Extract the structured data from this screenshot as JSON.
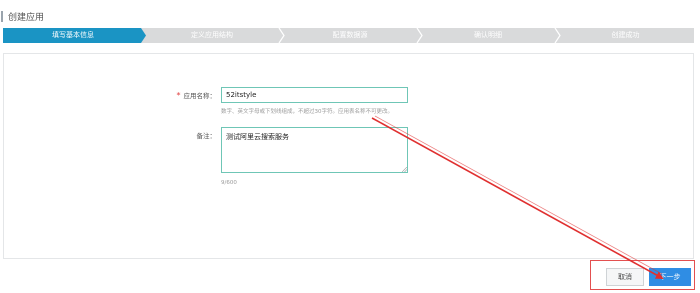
{
  "header": {
    "title": "创建应用"
  },
  "steps": [
    {
      "label": "填写基本信息",
      "active": true
    },
    {
      "label": "定义应用结构",
      "active": false
    },
    {
      "label": "配置数据源",
      "active": false
    },
    {
      "label": "确认明细",
      "active": false
    },
    {
      "label": "创建成功",
      "active": false
    }
  ],
  "form": {
    "name_label": "应用名称：",
    "name_required_mark": "*",
    "name_value": "52itstyle",
    "name_hint": "数字、英文字母或下划线组成，不超过30字符。应用表名称不可更改。",
    "remark_label": "备注：",
    "remark_value": "测试阿里云搜索服务",
    "remark_counter": "9/600"
  },
  "buttons": {
    "cancel": "取消",
    "next": "下一步"
  },
  "colors": {
    "active_step": "#1a94c4",
    "inactive_step": "#d9dadb",
    "input_border": "#6fc6b6",
    "primary_button": "#2f8de4",
    "annotation": "#e03030"
  }
}
